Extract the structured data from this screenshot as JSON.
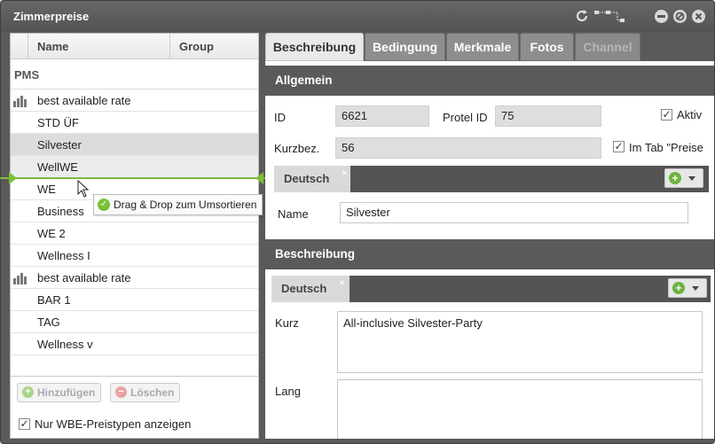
{
  "window": {
    "title": "Zimmerpreise"
  },
  "list": {
    "columns": {
      "name": "Name",
      "group": "Group"
    },
    "group_label": "PMS",
    "rows": [
      {
        "label": "best available rate",
        "icon": "bar-chart-icon"
      },
      {
        "label": "STD ÜF"
      },
      {
        "label": "Silvester"
      },
      {
        "label": "WellWE"
      },
      {
        "label": "WE"
      },
      {
        "label": "Business"
      },
      {
        "label": "WE 2"
      },
      {
        "label": "Wellness I"
      },
      {
        "label": "best available rate",
        "icon": "bar-chart-icon"
      },
      {
        "label": "BAR 1"
      },
      {
        "label": "TAG"
      },
      {
        "label": "Wellness v"
      }
    ],
    "tooltip": "Drag & Drop zum Umsortieren",
    "add_label": "Hinzufügen",
    "delete_label": "Löschen",
    "filter_label": "Nur WBE-Preistypen anzeigen"
  },
  "tabs": [
    "Beschreibung",
    "Bedingung",
    "Merkmale",
    "Fotos",
    "Channel"
  ],
  "general": {
    "header": "Allgemein",
    "id_label": "ID",
    "id_value": "6621",
    "protel_label": "Protel ID",
    "protel_value": "75",
    "aktiv_label": "Aktiv",
    "kurz_label": "Kurzbez.",
    "kurz_value": "56",
    "imtab_label": "Im Tab \"Preise",
    "lang_tab": "Deutsch",
    "close_x": "×",
    "name_label": "Name",
    "name_value": "Silvester"
  },
  "description": {
    "header": "Beschreibung",
    "lang_tab": "Deutsch",
    "close_x": "×",
    "short_label": "Kurz",
    "short_value": "All-inclusive Silvester-Party",
    "long_label": "Lang",
    "long_value": ""
  },
  "colors": {
    "accent_green": "#7bbf3a",
    "header_gray": "#5a5a5a"
  }
}
